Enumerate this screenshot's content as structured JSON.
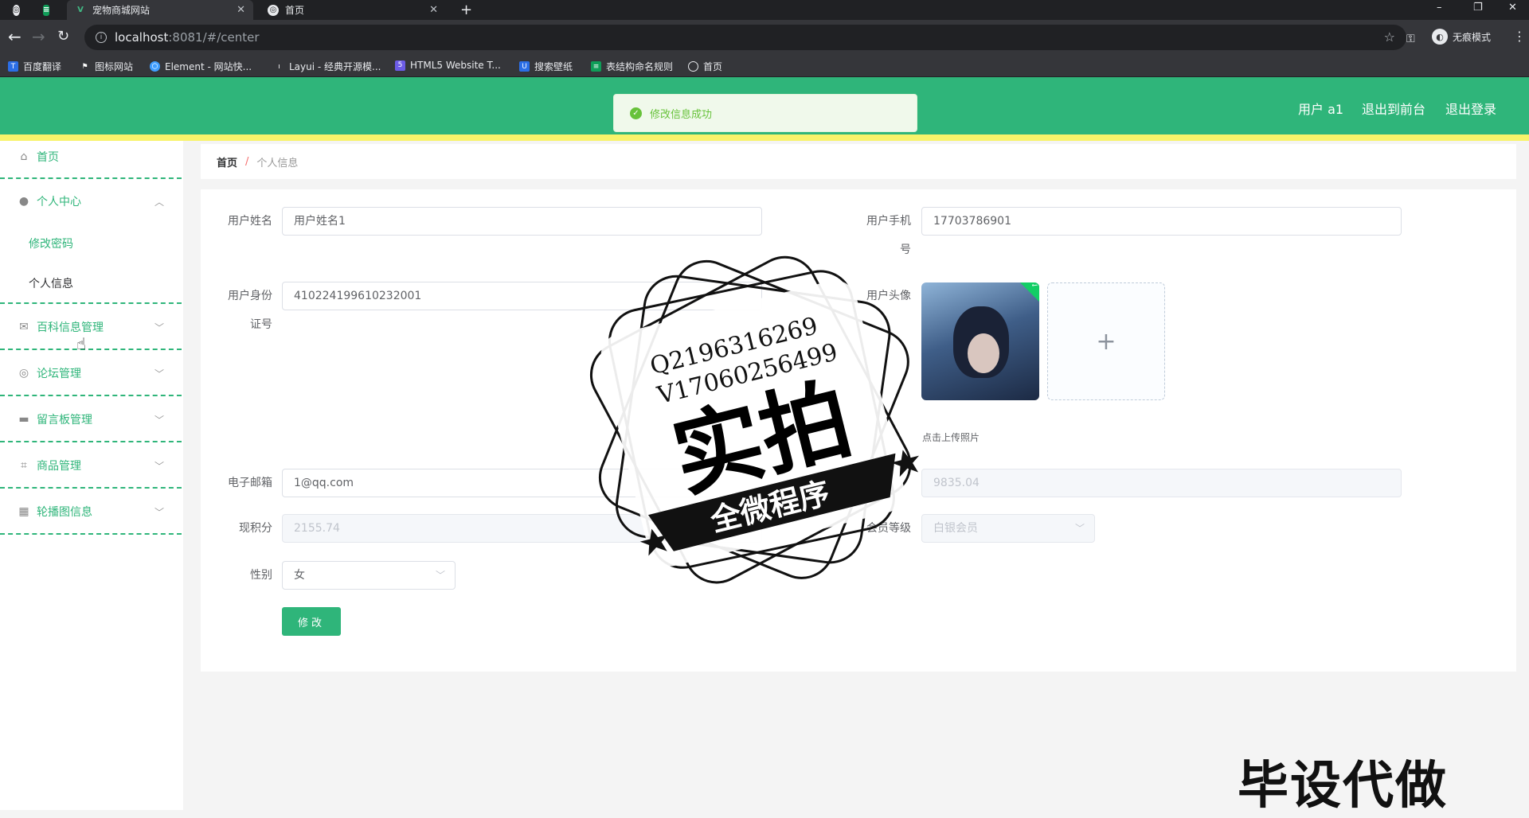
{
  "browser": {
    "tabs": [
      {
        "label": "宠物商城网站",
        "active": true
      },
      {
        "label": "首页",
        "active": false
      }
    ],
    "new_tab_icon": "+",
    "url_host": "localhost",
    "url_rest": ":8081/#/center",
    "incognito_label": "无痕模式",
    "bookmarks": [
      "百度翻译",
      "图标网站",
      "Element - 网站快...",
      "Layui - 经典开源模...",
      "HTML5 Website T...",
      "搜索壁纸",
      "表结构命名规则",
      "首页"
    ]
  },
  "header": {
    "user_label": "用户 a1",
    "back_to_front": "退出到前台",
    "logout": "退出登录",
    "toast": "修改信息成功",
    "accent": "#2fb57a",
    "stripe": "#f8f36a"
  },
  "sidebar": {
    "home": "首页",
    "personal_center": "个人中心",
    "change_password": "修改密码",
    "personal_info": "个人信息",
    "baike": "百科信息管理",
    "forum": "论坛管理",
    "guestbook": "留言板管理",
    "goods": "商品管理",
    "carousel": "轮播图信息"
  },
  "breadcrumb": {
    "home": "首页",
    "sep": "/",
    "current": "个人信息"
  },
  "form": {
    "username_label": "用户姓名",
    "username_value": "用户姓名1",
    "phone_label_1": "用户手机",
    "phone_label_2": "号",
    "phone_value": "17703786901",
    "idcard_label_1": "用户身份",
    "idcard_label_2": "证号",
    "idcard_value": "410224199610232001",
    "avatar_label": "用户头像",
    "upload_tip": "点击上传照片",
    "email_label": "电子邮箱",
    "email_value": "1@qq.com",
    "balance_value": "9835.04",
    "points_label": "现积分",
    "points_value": "2155.74",
    "member_label": "会员等级",
    "member_value": "白银会员",
    "gender_label": "性别",
    "gender_value": "女",
    "submit_label": "修改"
  },
  "watermark": {
    "qq": "Q2196316269",
    "vx": "V17060256499",
    "main": "实拍",
    "banner": "全微程序",
    "corner": "毕设代做"
  }
}
